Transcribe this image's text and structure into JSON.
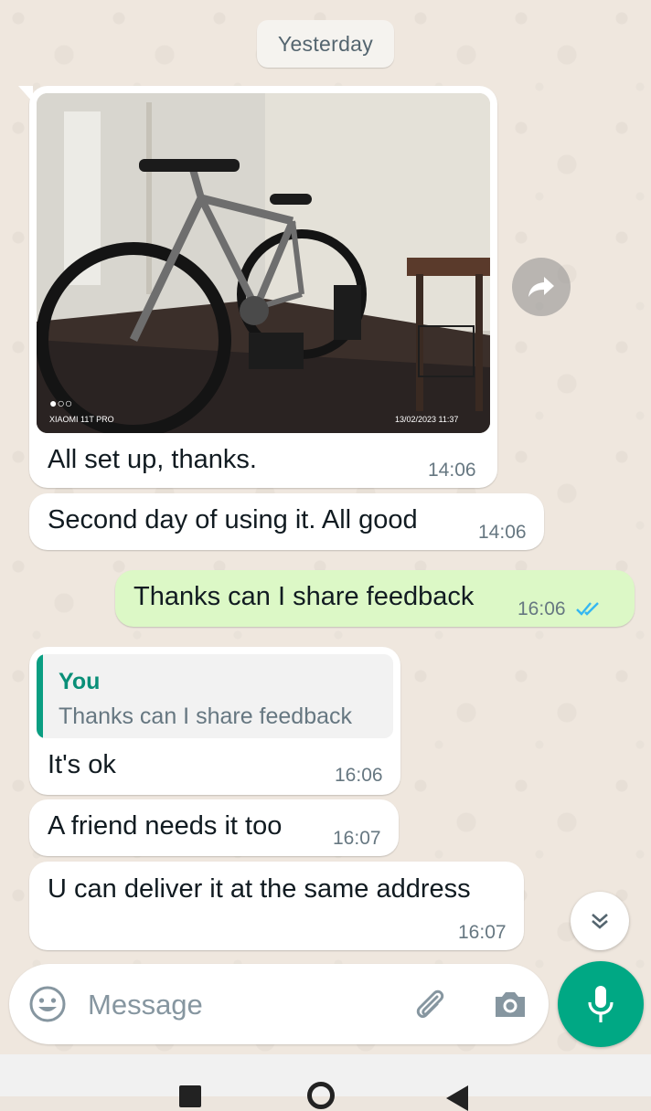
{
  "chat": {
    "date_separator": "Yesterday",
    "messages": [
      {
        "direction": "in",
        "type": "image",
        "photo_caption_left": "XIAOMI 11T PRO",
        "photo_caption_right": "13/02/2023  11:37",
        "text": "All set up, thanks.",
        "time": "14:06"
      },
      {
        "direction": "in",
        "type": "text",
        "text": "Second day of using it. All good",
        "time": "14:06"
      },
      {
        "direction": "out",
        "type": "text",
        "text": "Thanks can I share feedback",
        "time": "16:06",
        "status": "read"
      },
      {
        "direction": "in",
        "type": "reply",
        "quote_author": "You",
        "quote_text": "Thanks can I share feedback",
        "text": "It's ok",
        "time": "16:06"
      },
      {
        "direction": "in",
        "type": "text",
        "text": "A friend needs it too",
        "time": "16:07"
      },
      {
        "direction": "in",
        "type": "text",
        "text": "U can deliver it at the same address",
        "time": "16:07"
      }
    ]
  },
  "composer": {
    "placeholder": "Message",
    "icons": [
      "emoji-icon",
      "attach-icon",
      "camera-icon",
      "mic-icon"
    ]
  },
  "icons": {
    "forward": "forward-icon",
    "scroll_down": "double-chevron-down-icon",
    "read_receipt": "double-check-icon"
  },
  "colors": {
    "incoming_bubble": "#ffffff",
    "outgoing_bubble": "#dcf8c6",
    "accent": "#00a884",
    "read_tick": "#34b7f1",
    "quote_author": "#0a8f78"
  }
}
